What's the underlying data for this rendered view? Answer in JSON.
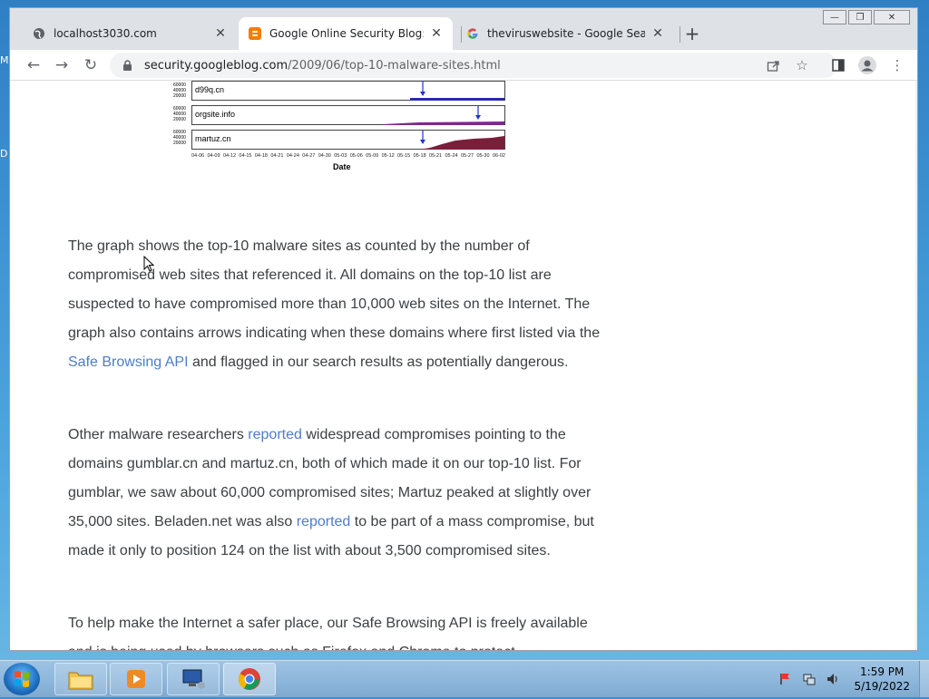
{
  "desktop": {
    "left_fragments": [
      "M",
      "D"
    ]
  },
  "browser": {
    "tabs": [
      {
        "title": "localhost3030.com",
        "icon": "globe-icon",
        "active": false
      },
      {
        "title": "Google Online Security Blog: Top",
        "icon": "blogger-icon",
        "active": true
      },
      {
        "title": "theviruswebsite - Google Search",
        "icon": "google-icon",
        "active": false
      }
    ],
    "new_tab_label": "+",
    "url_host": "security.googleblog.com",
    "url_path": "/2009/06/top-10-malware-sites.html"
  },
  "graph": {
    "panels": [
      "d99q.cn",
      "orgsite.info",
      "martuz.cn"
    ],
    "y_ticks": [
      "60000",
      "40000",
      "20000",
      "0"
    ],
    "x_ticks": [
      "04-06",
      "04-09",
      "04-12",
      "04-15",
      "04-18",
      "04-21",
      "04-24",
      "04-27",
      "04-30",
      "05-03",
      "05-06",
      "05-09",
      "05-12",
      "05-15",
      "05-18",
      "05-21",
      "05-24",
      "05-27",
      "05-30",
      "06-02"
    ],
    "x_title": "Date",
    "colors": {
      "d99q": "#2a2ab0",
      "orgsite": "#7b2a8a",
      "martuz": "#7a1f3a",
      "arrow": "#2233cc"
    }
  },
  "article": {
    "p1_a": "The graph shows the top-10 malware sites as counted by the number of compromised web sites that referenced it. All domains on the top-10 list are suspected to have compromised more than 10,000 web sites on the Internet. The graph also contains arrows indicating when these domains where first listed via the ",
    "p1_link": "Safe Browsing API",
    "p1_b": " and flagged in our search results as potentially dangerous.",
    "p2_a": "Other malware researchers ",
    "p2_link1": "reported",
    "p2_b": " widespread compromises pointing to the domains gumblar.cn and martuz.cn, both of which made it on our top-10 list. For gumblar, we saw about 60,000 compromised sites; Martuz peaked at slightly over 35,000 sites. Beladen.net was also ",
    "p2_link2": "reported",
    "p2_c": " to be part of a mass compromise, but made it only to position 124 on the list with about 3,500 compromised sites.",
    "p3": "To help make the Internet a safer place, our Safe Browsing API is freely available and is being used by browsers such as Firefox and Chrome to protect"
  },
  "taskbar": {
    "time": "1:59 PM",
    "date": "5/19/2022"
  }
}
